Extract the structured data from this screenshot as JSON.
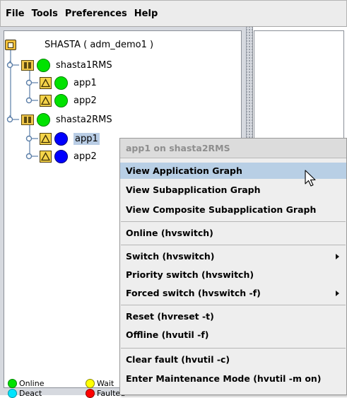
{
  "menubar": {
    "items": [
      "File",
      "Tools",
      "Preferences",
      "Help"
    ]
  },
  "tree": {
    "root": {
      "label": "SHASTA ( adm_demo1 )",
      "icon": "cluster-icon"
    },
    "systems": [
      {
        "label": "shasta1RMS",
        "status": "online",
        "status_color": "#00e200",
        "apps": [
          {
            "label": "app1",
            "status": "online",
            "status_color": "#00e200"
          },
          {
            "label": "app2",
            "status": "online",
            "status_color": "#00e200"
          }
        ]
      },
      {
        "label": "shasta2RMS",
        "status": "online",
        "status_color": "#00e200",
        "apps": [
          {
            "label": "app1",
            "status": "offline",
            "status_color": "#0000ff",
            "selected": true
          },
          {
            "label": "app2",
            "status": "offline",
            "status_color": "#0000ff"
          }
        ]
      }
    ]
  },
  "legend": {
    "items": [
      {
        "label": "Online",
        "color": "#00e200"
      },
      {
        "label": "Wait",
        "color": "#ffff00"
      },
      {
        "label": "Deact",
        "color": "#00e5ff"
      },
      {
        "label": "Faulted",
        "color": "#ff0000"
      }
    ]
  },
  "context_menu": {
    "title": "app1 on shasta2RMS",
    "items": [
      {
        "label": "View Application Graph",
        "hover": true
      },
      {
        "label": "View Subapplication Graph"
      },
      {
        "label": "View Composite Subapplication Graph"
      },
      {
        "label": "Online (hvswitch)"
      },
      {
        "label": "Switch (hvswitch)",
        "submenu": true
      },
      {
        "label": "Priority switch (hvswitch)"
      },
      {
        "label": "Forced switch (hvswitch -f)",
        "submenu": true
      },
      {
        "label": "Reset (hvreset -t)"
      },
      {
        "label": "Offline (hvutil -f)"
      },
      {
        "label": "Clear fault (hvutil -c)"
      },
      {
        "label": "Enter Maintenance Mode (hvutil -m on)"
      }
    ]
  }
}
